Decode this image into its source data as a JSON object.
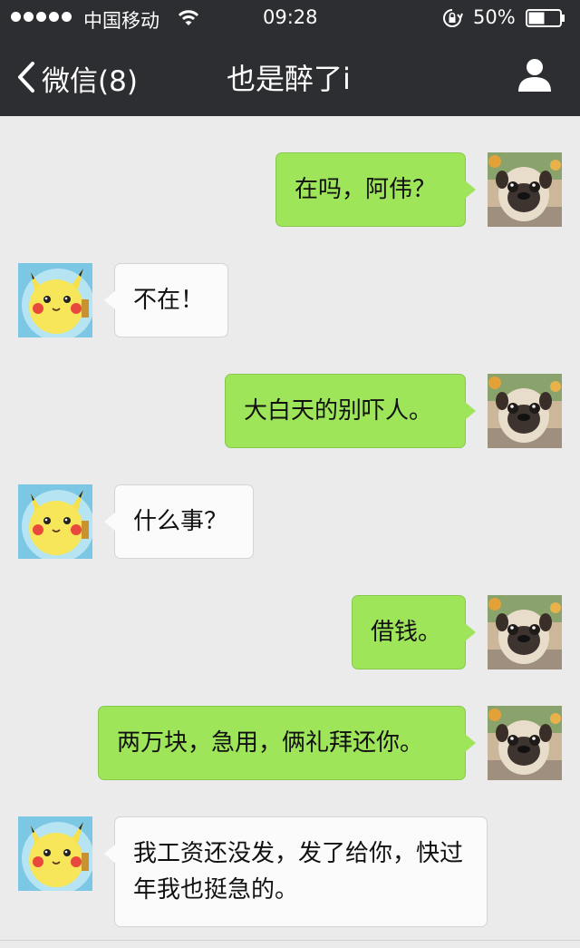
{
  "status_bar": {
    "carrier": "中国移动",
    "time": "09:28",
    "battery": "50%",
    "battery_level": 0.5,
    "signal_bars": 5
  },
  "nav": {
    "back_label": "微信(8)",
    "title": "也是醉了i"
  },
  "messages": [
    {
      "from": "me",
      "text": "在吗，阿伟？"
    },
    {
      "from": "other",
      "text": "不在！"
    },
    {
      "from": "me",
      "text": "大白天的别吓人。"
    },
    {
      "from": "other",
      "text": "什么事？"
    },
    {
      "from": "me",
      "text": "借钱。"
    },
    {
      "from": "me",
      "text": "两万块，急用，俩礼拜还你。"
    },
    {
      "from": "other",
      "text": "我工资还没发，发了给你，快过年我也挺急的。"
    }
  ],
  "colors": {
    "bar": "#2d2e32",
    "outgoing_bubble": "#9ee55a",
    "incoming_bubble": "#fbfbfb",
    "chat_bg": "#ebebeb"
  },
  "icons": [
    "wifi-icon",
    "rotation-lock-icon",
    "battery-icon",
    "back-chevron-icon",
    "profile-icon",
    "pug-avatar",
    "pikachu-avatar"
  ]
}
